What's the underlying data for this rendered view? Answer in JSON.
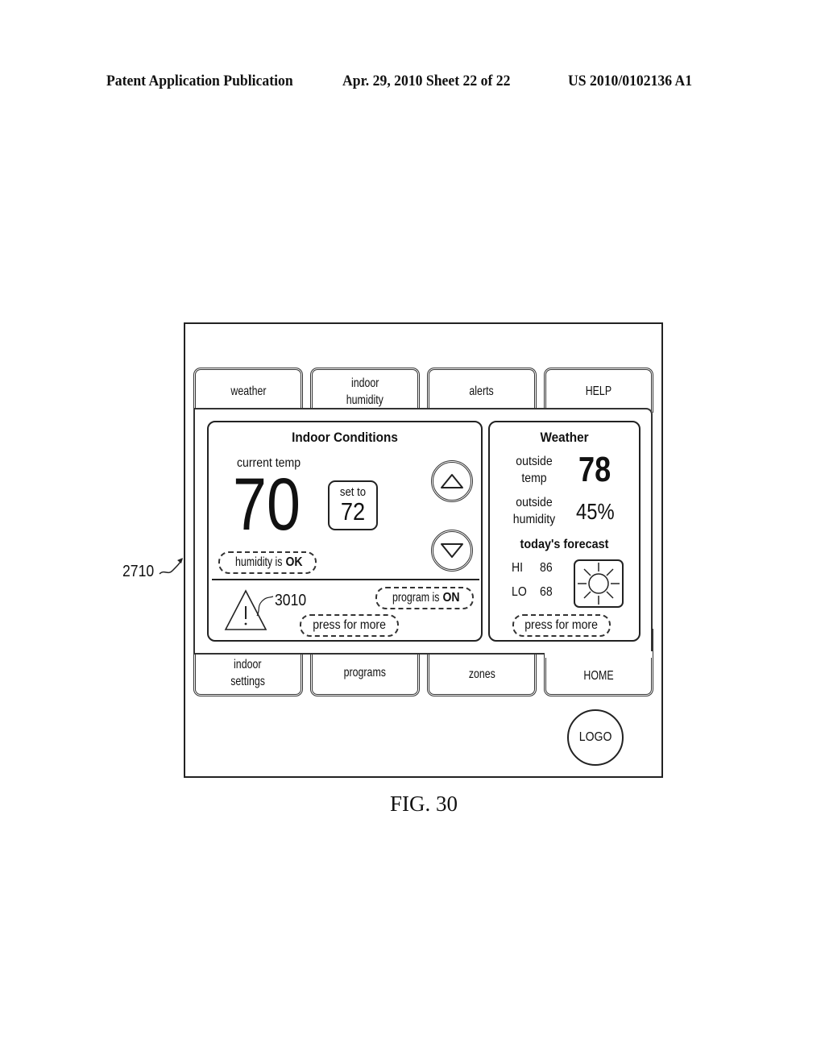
{
  "header": {
    "publication": "Patent Application Publication",
    "date_sheet": "Apr. 29, 2010  Sheet 22 of 22",
    "number": "US 2010/0102136 A1"
  },
  "figure": {
    "reference_label": "2710",
    "caption": "FIG. 30",
    "warning_reference": "3010"
  },
  "top_tabs": [
    {
      "label_line1": "weather",
      "label_line2": ""
    },
    {
      "label_line1": "indoor",
      "label_line2": "humidity"
    },
    {
      "label_line1": "alerts",
      "label_line2": ""
    },
    {
      "label_line1": "HELP",
      "label_line2": ""
    }
  ],
  "bottom_tabs": [
    {
      "label_line1": "indoor",
      "label_line2": "settings"
    },
    {
      "label_line1": "programs",
      "label_line2": ""
    },
    {
      "label_line1": "zones",
      "label_line2": ""
    },
    {
      "label_line1": "HOME",
      "label_line2": "",
      "active": true
    }
  ],
  "indoor": {
    "title": "Indoor Conditions",
    "current_temp_label": "current temp",
    "current_temp": "70",
    "set_to_label": "set to",
    "set_to_value": "72",
    "humidity_status_prefix": "humidity is ",
    "humidity_status": "OK",
    "program_status_prefix": "program is ",
    "program_status": "ON",
    "press_for_more": "press for more"
  },
  "weather": {
    "title": "Weather",
    "outside_temp_label_1": "outside",
    "outside_temp_label_2": "temp",
    "outside_temp": "78",
    "outside_humidity_label_1": "outside",
    "outside_humidity_label_2": "humidity",
    "outside_humidity": "45%",
    "forecast_title": "today's forecast",
    "hi_label": "HI",
    "hi_value": "86",
    "lo_label": "LO",
    "lo_value": "68",
    "forecast_icon": "sun-icon",
    "press_for_more": "press for more"
  },
  "logo": {
    "label": "LOGO"
  }
}
